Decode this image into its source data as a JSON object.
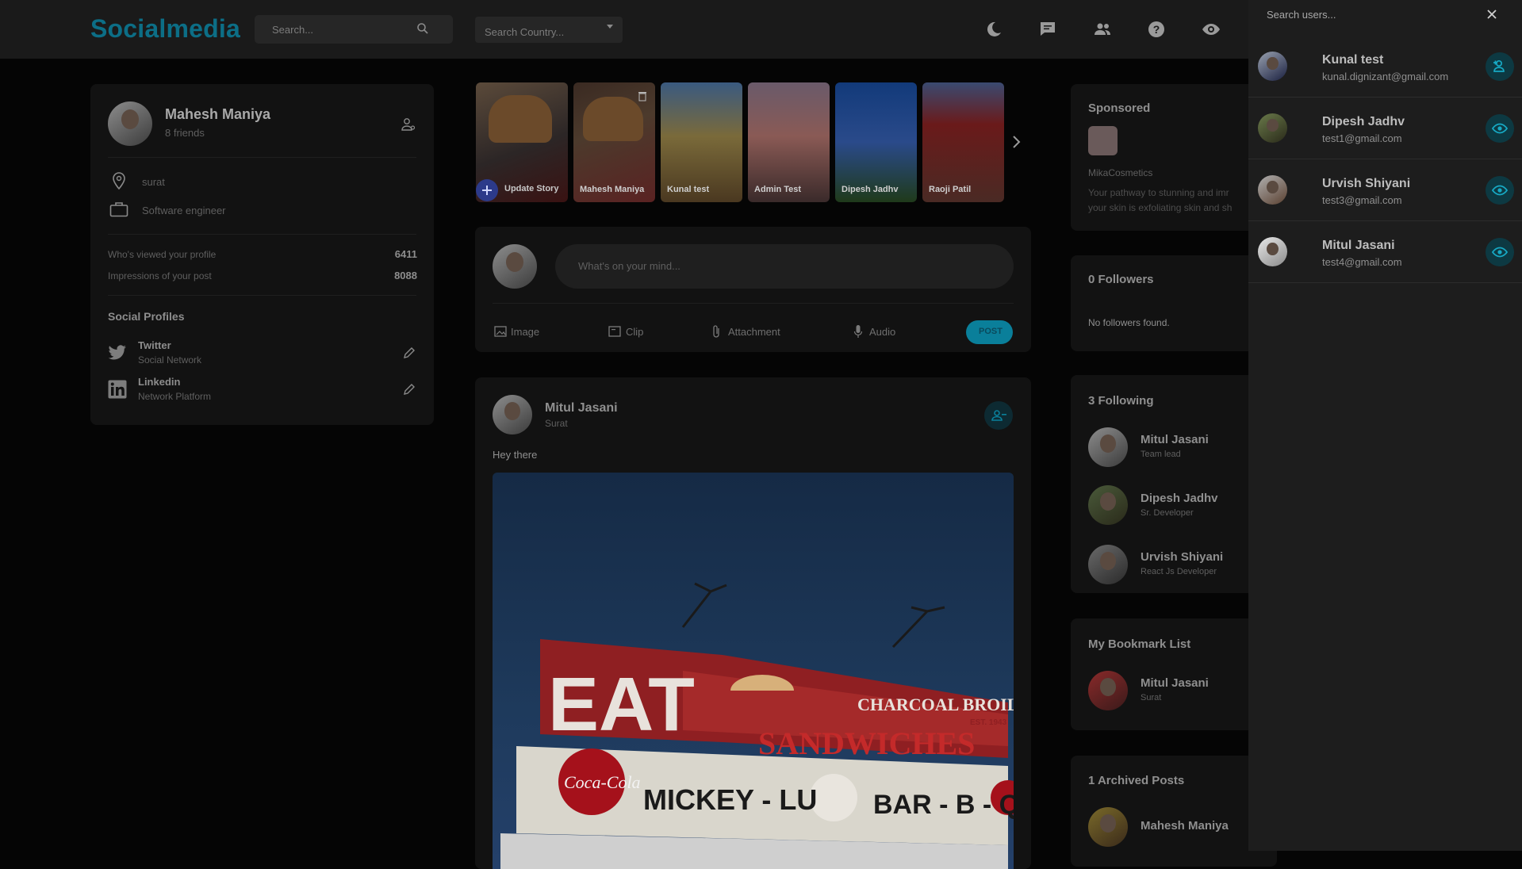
{
  "app": {
    "logo": "Socialmedia"
  },
  "header": {
    "search_placeholder": "Search...",
    "country_placeholder": "Search Country..."
  },
  "profile": {
    "name": "Mahesh Maniya",
    "friends": "8 friends",
    "location": "surat",
    "occupation": "Software engineer",
    "stats": [
      {
        "label": "Who's viewed your profile",
        "value": "6411"
      },
      {
        "label": "Impressions of your post",
        "value": "8088"
      }
    ],
    "social_title": "Social Profiles",
    "socials": [
      {
        "name": "Twitter",
        "sub": "Social Network"
      },
      {
        "name": "Linkedin",
        "sub": "Network Platform"
      }
    ]
  },
  "stories": {
    "update_label": "Update Story",
    "items": [
      {
        "label": "Mahesh Maniya"
      },
      {
        "label": "Kunal test"
      },
      {
        "label": "Admin Test"
      },
      {
        "label": "Dipesh Jadhv"
      },
      {
        "label": "Raoji Patil"
      }
    ]
  },
  "composer": {
    "placeholder": "What's on your mind...",
    "actions": [
      "Image",
      "Clip",
      "Attachment",
      "Audio"
    ],
    "post_label": "POST"
  },
  "post": {
    "author": "Mitul Jasani",
    "location": "Surat",
    "text": "Hey there",
    "sign_texts": [
      "EAT",
      "CHARCOAL BROILED",
      "SANDWICHES",
      "MICKEY - LU",
      "BAR - B - Q",
      "Coca-Cola",
      "EST. 1943"
    ]
  },
  "sponsored": {
    "title": "Sponsored",
    "brand": "MikaCosmetics",
    "desc_line1": "Your pathway to stunning and imr",
    "desc_line2": "your skin is exfoliating skin and sh"
  },
  "followers": {
    "title": "0 Followers",
    "empty": "No followers found."
  },
  "following": {
    "title": "3 Following",
    "items": [
      {
        "name": "Mitul Jasani",
        "sub": "Team lead"
      },
      {
        "name": "Dipesh Jadhv",
        "sub": "Sr. Developer"
      },
      {
        "name": "Urvish Shiyani",
        "sub": "React Js Developer"
      }
    ]
  },
  "bookmarks": {
    "title": "My Bookmark List",
    "items": [
      {
        "name": "Mitul Jasani",
        "sub": "Surat"
      }
    ]
  },
  "archived": {
    "title": "1 Archived Posts",
    "items": [
      {
        "name": "Mahesh Maniya"
      }
    ]
  },
  "drawer": {
    "search_placeholder": "Search users...",
    "users": [
      {
        "name": "Kunal test",
        "email": "kunal.dignizant@gmail.com",
        "action": "add-user"
      },
      {
        "name": "Dipesh Jadhv",
        "email": "test1@gmail.com",
        "action": "view"
      },
      {
        "name": "Urvish Shiyani",
        "email": "test3@gmail.com",
        "action": "view"
      },
      {
        "name": "Mitul Jasani",
        "email": "test4@gmail.com",
        "action": "view"
      }
    ]
  },
  "colors": {
    "brand": "#0c6e86",
    "accent_button": "#0a7f9a",
    "background": "#050505",
    "card": "#121212",
    "drawer": "#1d1d1d"
  }
}
